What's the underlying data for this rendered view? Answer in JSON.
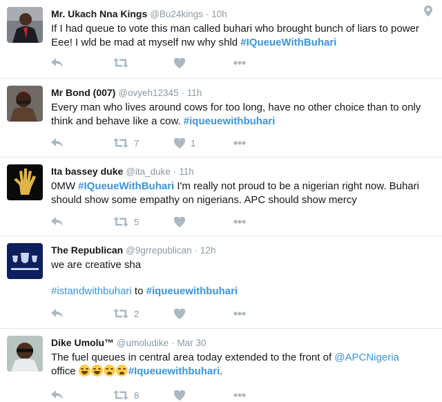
{
  "colors": {
    "link": "#3b94d9",
    "muted": "#8899a6",
    "icon": "#aab8c2",
    "divider": "#e1e8ed"
  },
  "icons": {
    "reply": "reply-icon",
    "retweet": "retweet-icon",
    "like": "heart-icon",
    "more": "more-icon",
    "location": "location-pin-icon"
  },
  "tweets": [
    {
      "name": "Mr. Ukach Nna Kings",
      "handle": "@Bu24kings",
      "dot": "·",
      "time": "10h",
      "line1": "If I had queue to vote this man called buhari who brought bunch of liars to power",
      "line2_text": "Eee! I wld be mad at myself nw why shld ",
      "hashtag": "#IQueueWithBuhari",
      "retweets": "",
      "likes": ""
    },
    {
      "name": "Mr Bond (007)",
      "handle": "@ovyeh12345",
      "dot": "·",
      "time": "11h",
      "line1": "Every man who lives around cows for too long, have no other choice than to only",
      "line2_text": "think and behave like a cow. ",
      "hashtag": "#iqueuewithbuhari",
      "retweets": "7",
      "likes": "1"
    },
    {
      "name": "Ita bassey duke",
      "handle": "@ita_duke",
      "dot": "·",
      "time": "11h",
      "line1_prefix": "0MW ",
      "hashtag": "#IQueueWithBuhari",
      "line1_suffix": " I'm really not proud to be a nigerian right now. Buhari",
      "line2": "should show some empathy on nigerians. APC should show mercy",
      "retweets": "5",
      "likes": ""
    },
    {
      "name": "The Republican",
      "handle": "@9grrepublican",
      "dot": "·",
      "time": "12h",
      "line1": "we are creative sha",
      "hashtag_a": "#istandwithbuhari",
      "middle": " to ",
      "hashtag_b": "#iqueuewithbuhari",
      "retweets": "2",
      "likes": ""
    },
    {
      "name": "Dike Umolu™",
      "handle": "@umoludike",
      "dot": "·",
      "time": "Mar 30",
      "line1": "The fuel queues in central area today extended to the front of ",
      "mention": "@APCNigeria",
      "line2_text": "office ",
      "hashtag": "#Iqueuewithbuhari",
      "line2_end": ".",
      "retweets": "8",
      "likes": ""
    }
  ]
}
